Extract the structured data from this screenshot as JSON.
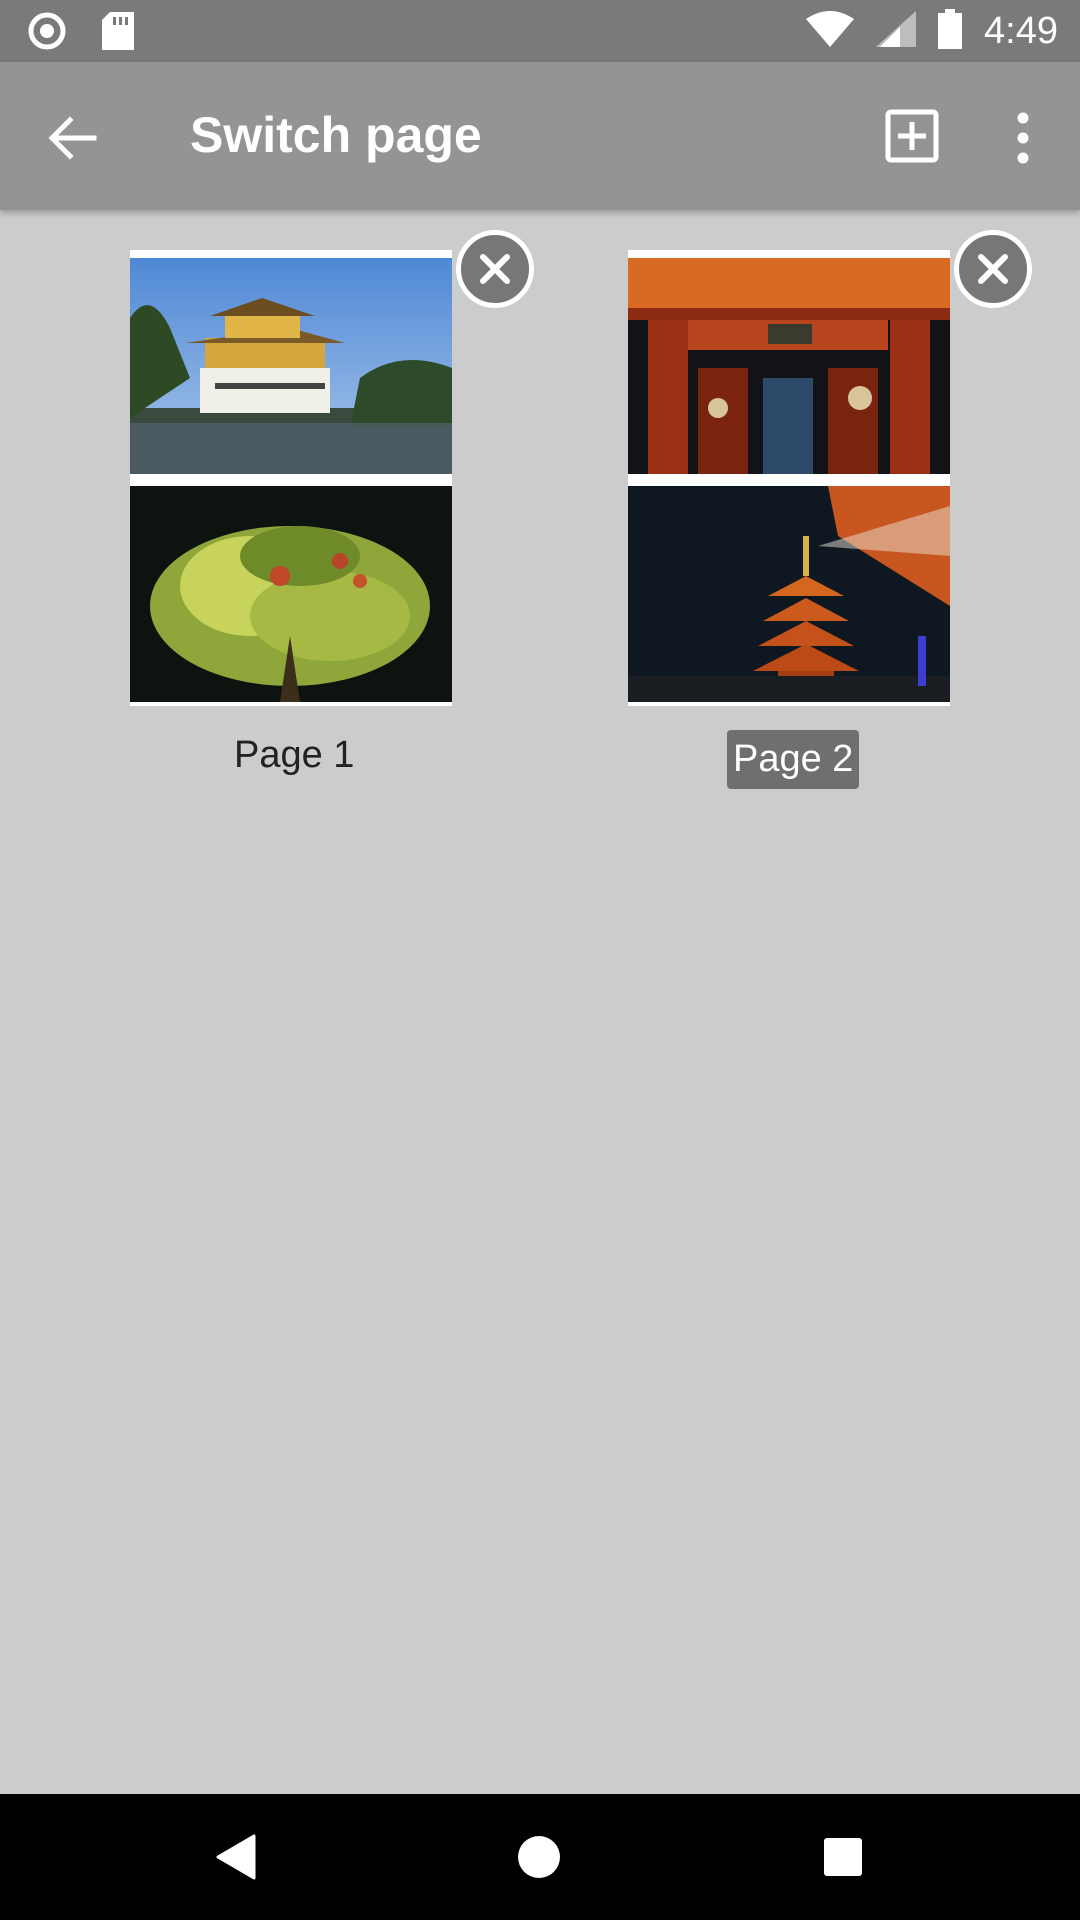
{
  "status_bar": {
    "time": "4:49",
    "icons": [
      "record-icon",
      "sd-card-icon",
      "wifi-icon",
      "signal-icon",
      "battery-icon"
    ]
  },
  "app_bar": {
    "title": "Switch page",
    "icons": [
      "back-arrow-icon",
      "add-page-icon",
      "more-vert-icon"
    ]
  },
  "pages": [
    {
      "label": "Page 1",
      "selected": false,
      "photos": [
        "golden-pavilion-photo",
        "autumn-maple-night-photo"
      ]
    },
    {
      "label": "Page 2",
      "selected": true,
      "photos": [
        "temple-gate-night-photo",
        "pagoda-night-photo"
      ]
    }
  ],
  "nav_bar": {
    "icons": [
      "nav-back-icon",
      "nav-home-icon",
      "nav-recents-icon"
    ]
  },
  "colors": {
    "status_bar": "#7a7a7a",
    "app_bar": "#949494",
    "background": "#cccccc",
    "selected_label_bg": "#6f6f6f",
    "close_button": "#777777"
  }
}
